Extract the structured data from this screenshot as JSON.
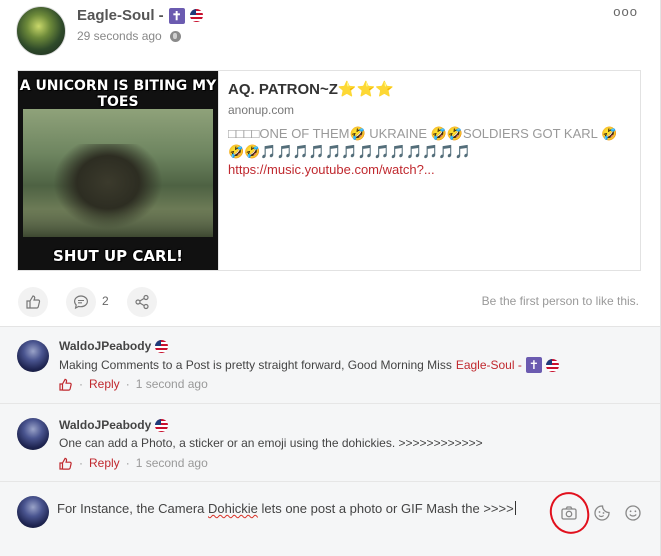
{
  "post": {
    "author": "Eagle-Soul -",
    "author_badge_glyph": "✝",
    "timestamp": "29 seconds ago",
    "more_label": "ooo",
    "link_card": {
      "meme_top_text": "A UNICORN IS BITING MY TOES",
      "meme_bottom_text": "SHUT UP CARL!",
      "title": "AQ. PATRON~Z⭐⭐⭐",
      "domain": "anonup.com",
      "description": "□□□□ONE OF THEM🤣 UKRAINE 🤣🤣SOLDIERS GOT KARL 🤣🤣🤣🎵🎵🎵🎵🎵🎵🎵🎵🎵🎵🎵🎵🎵",
      "url": "https://music.youtube.com/watch?..."
    },
    "actions": {
      "comment_count": "2",
      "like_prompt": "Be the first person to like this."
    }
  },
  "comments": [
    {
      "author": "WaldoJPeabody",
      "text": "Making Comments to a Post is pretty straight forward, Good Morning Miss",
      "mention": "Eagle-Soul -",
      "mention_badge_glyph": "✝",
      "reply_label": "Reply",
      "time": "1 second ago"
    },
    {
      "author": "WaldoJPeabody",
      "text": "One can add a Photo, a sticker or an emoji using the dohickies. >>>>>>>>>>>>",
      "reply_label": "Reply",
      "time": "1 second ago"
    }
  ],
  "composer": {
    "text_before": "For Instance, the Camera ",
    "misspelled": "Dohickie",
    "text_after": " lets one post a photo or GIF Mash the >>>>"
  },
  "colors": {
    "accent_red": "#c0292f",
    "annotation_red": "#e1101d",
    "badge_purple": "#6b5bb0"
  }
}
